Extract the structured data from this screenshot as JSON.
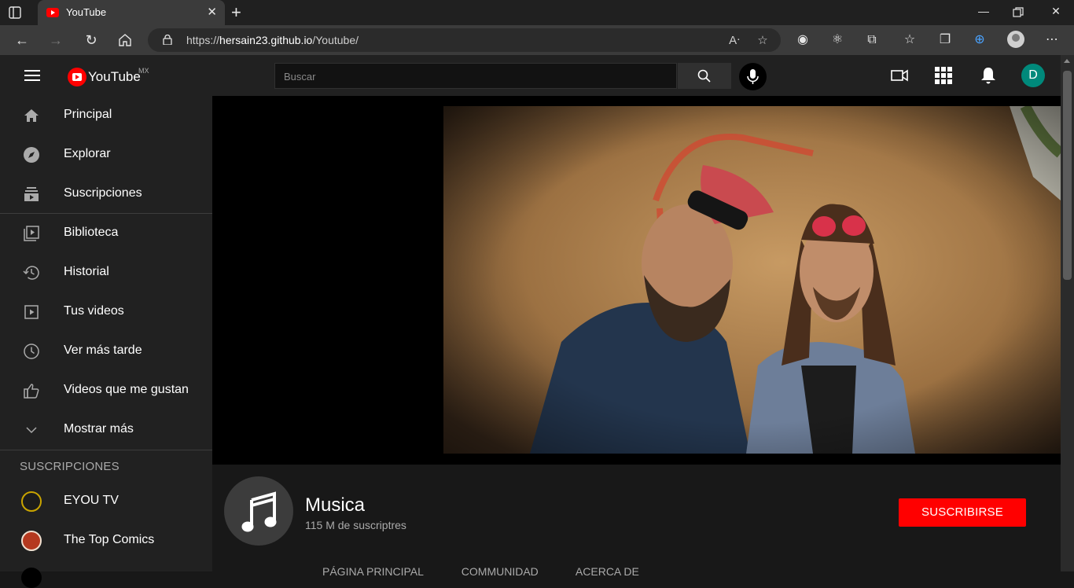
{
  "browser": {
    "tab_title": "YouTube",
    "url_prefix": "https://",
    "url_host": "hersain23.github.io",
    "url_path": "/Youtube/"
  },
  "header": {
    "logo_text": "YouTube",
    "region": "MX",
    "search_placeholder": "Buscar",
    "avatar_letter": "D"
  },
  "sidebar": {
    "items": [
      {
        "label": "Principal",
        "icon": "home-icon"
      },
      {
        "label": "Explorar",
        "icon": "compass-icon"
      },
      {
        "label": "Suscripciones",
        "icon": "subscriptions-icon"
      },
      {
        "label": "Biblioteca",
        "icon": "library-icon"
      },
      {
        "label": "Historial",
        "icon": "history-icon"
      },
      {
        "label": "Tus videos",
        "icon": "your-videos-icon"
      },
      {
        "label": "Ver más tarde",
        "icon": "clock-icon"
      },
      {
        "label": "Videos que me gustan",
        "icon": "thumbs-up-icon"
      },
      {
        "label": "Mostrar más",
        "icon": "chevron-down-icon"
      }
    ],
    "subscriptions_title": "SUSCRIPCIONES",
    "subscriptions": [
      {
        "label": "EYOU TV"
      },
      {
        "label": "The Top Comics"
      }
    ]
  },
  "channel": {
    "name": "Musica",
    "subscribers": "115 M de suscriptres",
    "subscribe_label": "SUSCRIBIRSE",
    "tabs": [
      "PÁGINA PRINCIPAL",
      "COMMUNIDAD",
      "ACERCA DE"
    ]
  },
  "colors": {
    "accent": "#ff0000",
    "avatar": "#00897b",
    "sidebar_bg": "#212121",
    "page_bg": "#181818"
  }
}
